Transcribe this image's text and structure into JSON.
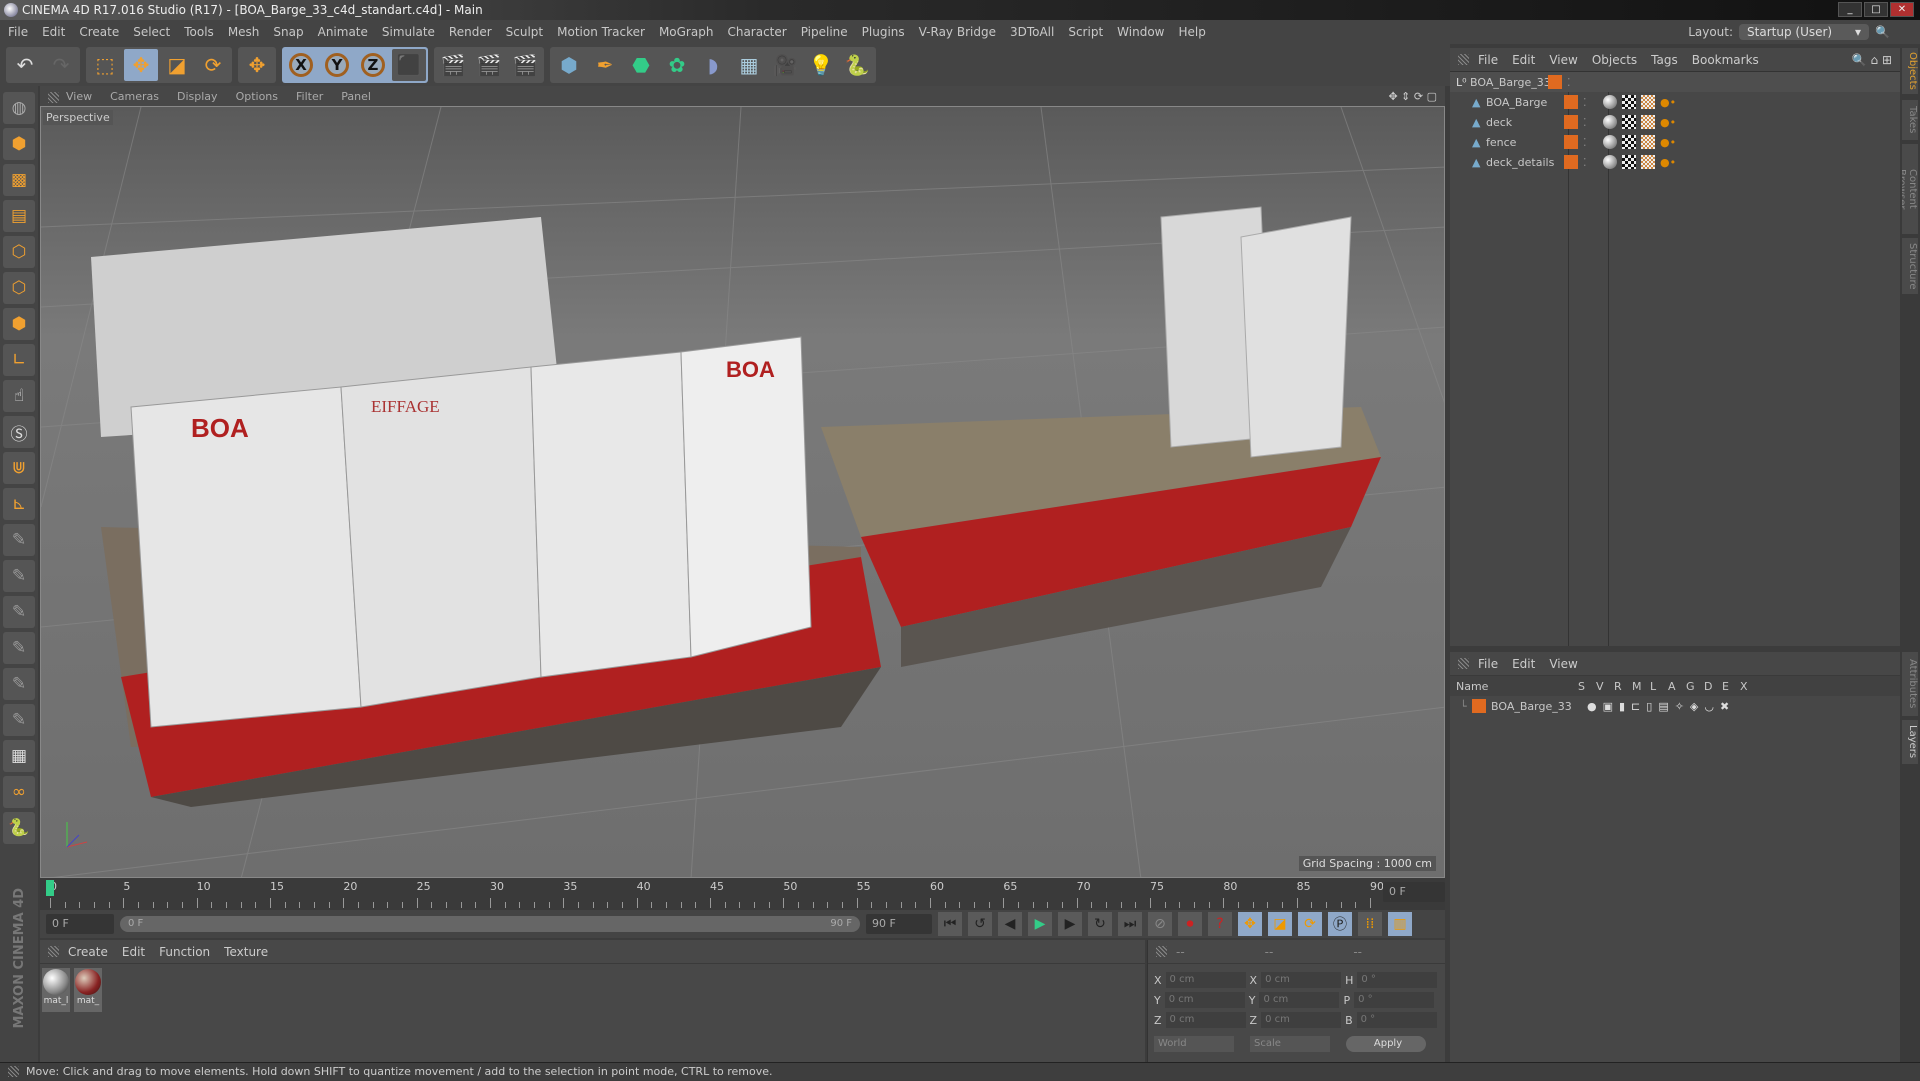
{
  "title": "CINEMA 4D R17.016 Studio (R17) - [BOA_Barge_33_c4d_standart.c4d] - Main",
  "menu": [
    "File",
    "Edit",
    "Create",
    "Select",
    "Tools",
    "Mesh",
    "Snap",
    "Animate",
    "Simulate",
    "Render",
    "Sculpt",
    "Motion Tracker",
    "MoGraph",
    "Character",
    "Pipeline",
    "Plugins",
    "V-Ray Bridge",
    "3DToAll",
    "Script",
    "Window",
    "Help"
  ],
  "layout": {
    "label": "Layout:",
    "value": "Startup (User)"
  },
  "viewport": {
    "menu": [
      "View",
      "Cameras",
      "Display",
      "Options",
      "Filter",
      "Panel"
    ],
    "label": "Perspective",
    "grid": "Grid Spacing : 1000 cm"
  },
  "timeline": {
    "ticks": [
      "0",
      "5",
      "10",
      "15",
      "20",
      "25",
      "30",
      "35",
      "40",
      "45",
      "50",
      "55",
      "60",
      "65",
      "70",
      "75",
      "80",
      "85",
      "90"
    ],
    "current": "0 F",
    "start": "0 F",
    "range_start": "0 F",
    "range_end": "90 F",
    "end": "90 F"
  },
  "materials": {
    "menu": [
      "Create",
      "Edit",
      "Function",
      "Texture"
    ],
    "items": [
      "mat_l",
      "mat_"
    ]
  },
  "coords": {
    "headers": [
      "--",
      "--",
      "--"
    ],
    "rows": [
      {
        "a": "X",
        "v1": "0 cm",
        "b": "X",
        "v2": "0 cm",
        "c": "H",
        "v3": "0 °"
      },
      {
        "a": "Y",
        "v1": "0 cm",
        "b": "Y",
        "v2": "0 cm",
        "c": "P",
        "v3": "0 °"
      },
      {
        "a": "Z",
        "v1": "0 cm",
        "b": "Z",
        "v2": "0 cm",
        "c": "B",
        "v3": "0 °"
      }
    ],
    "space": "World",
    "mode": "Scale",
    "apply": "Apply"
  },
  "status": "Move: Click and drag to move elements. Hold down SHIFT to quantize movement / add to the selection in point mode, CTRL to remove.",
  "objects": {
    "menu": [
      "File",
      "Edit",
      "View",
      "Objects",
      "Tags",
      "Bookmarks"
    ],
    "items": [
      "BOA_Barge_33",
      "BOA_Barge",
      "deck",
      "fence",
      "deck_details"
    ]
  },
  "layers": {
    "menu": [
      "File",
      "Edit",
      "View"
    ],
    "columns": [
      "Name",
      "S",
      "V",
      "R",
      "M",
      "L",
      "A",
      "G",
      "D",
      "E",
      "X"
    ],
    "items": [
      "BOA_Barge_33"
    ]
  },
  "right_tabs": [
    "Objects",
    "Takes",
    "Content Browser",
    "Structure",
    "Attributes",
    "Layers"
  ],
  "brand": "MAXON CINEMA 4D",
  "scene_text": [
    "BOA",
    "EIFFAGE",
    "BOA"
  ],
  "colors": {
    "accent": "#e06a20",
    "selected_blue": "#8fa8c8",
    "hull_red": "#b02020"
  }
}
